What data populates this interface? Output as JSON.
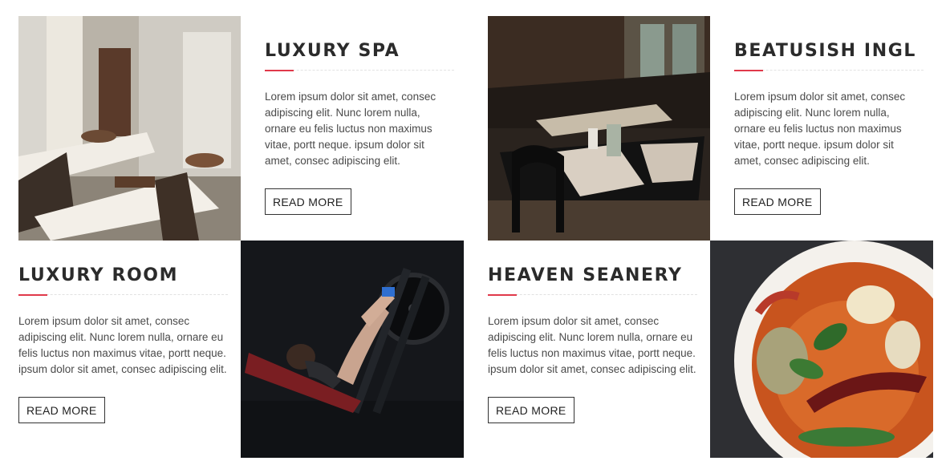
{
  "cards": [
    {
      "title": "LUXURY SPA",
      "text": "Lorem ipsum dolor sit amet, consec adipiscing elit. Nunc lorem nulla, ornare eu felis luctus non maximus vitae, portt neque. ipsum dolor sit amet, consec adipiscing elit.",
      "button": "READ MORE"
    },
    {
      "title": "BEATUSISH INGL",
      "text": "Lorem ipsum dolor sit amet, consec adipiscing elit. Nunc lorem nulla, ornare eu felis luctus non maximus vitae, portt neque. ipsum dolor sit amet, consec adipiscing elit.",
      "button": "READ MORE"
    },
    {
      "title": "LUXURY ROOM",
      "text": "Lorem ipsum dolor sit amet, consec adipiscing elit. Nunc lorem nulla, ornare eu felis luctus non maximus vitae, portt neque. ipsum dolor sit amet, consec adipiscing elit.",
      "button": "READ MORE"
    },
    {
      "title": "HEAVEN SEANERY",
      "text": "Lorem ipsum dolor sit amet, consec adipiscing elit. Nunc lorem nulla, ornare eu felis luctus non maximus vitae, portt neque. ipsum dolor sit amet, consec adipiscing elit.",
      "button": "READ MORE"
    }
  ],
  "accent_color": "#e0394a",
  "images": {
    "spa": "spa-room-photo",
    "restaurant": "restaurant-interior-photo",
    "gym": "gym-leg-press-photo",
    "food": "curry-bowl-photo"
  }
}
